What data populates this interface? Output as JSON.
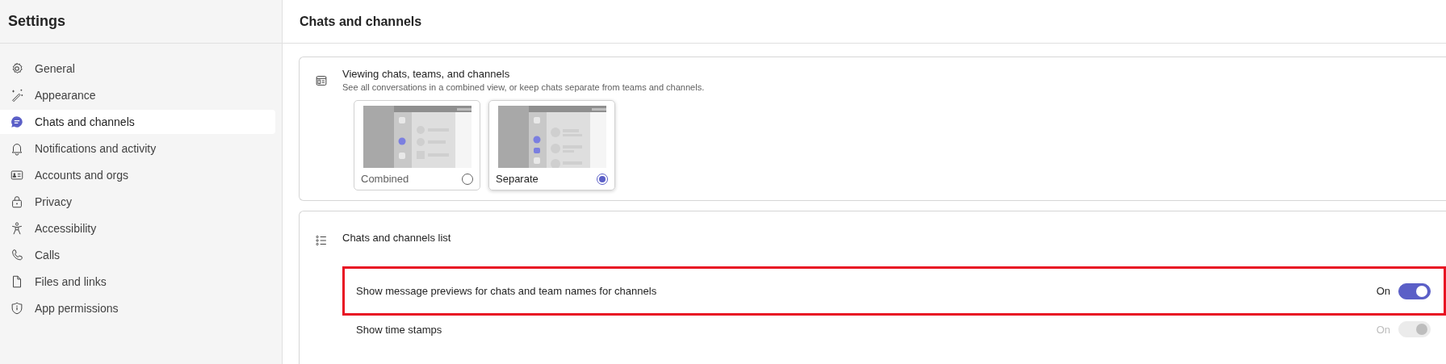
{
  "sidebar": {
    "title": "Settings",
    "items": [
      {
        "label": "General",
        "selected": false
      },
      {
        "label": "Appearance",
        "selected": false
      },
      {
        "label": "Chats and channels",
        "selected": true
      },
      {
        "label": "Notifications and activity",
        "selected": false
      },
      {
        "label": "Accounts and orgs",
        "selected": false
      },
      {
        "label": "Privacy",
        "selected": false
      },
      {
        "label": "Accessibility",
        "selected": false
      },
      {
        "label": "Calls",
        "selected": false
      },
      {
        "label": "Files and links",
        "selected": false
      },
      {
        "label": "App permissions",
        "selected": false
      }
    ]
  },
  "page": {
    "title": "Chats and channels"
  },
  "view_section": {
    "title": "Viewing chats, teams, and channels",
    "description": "See all conversations in a combined view, or keep chats separate from teams and channels.",
    "options": [
      {
        "label": "Combined",
        "kind": "combined",
        "selected": false
      },
      {
        "label": "Separate",
        "kind": "separate",
        "selected": true
      }
    ]
  },
  "list_section": {
    "title": "Chats and channels list",
    "settings": [
      {
        "label": "Show message previews for chats and team names for channels",
        "state": "On",
        "on": true,
        "disabled": false,
        "highlighted": true
      },
      {
        "label": "Show time stamps",
        "state": "On",
        "on": true,
        "disabled": true,
        "highlighted": false
      }
    ]
  }
}
